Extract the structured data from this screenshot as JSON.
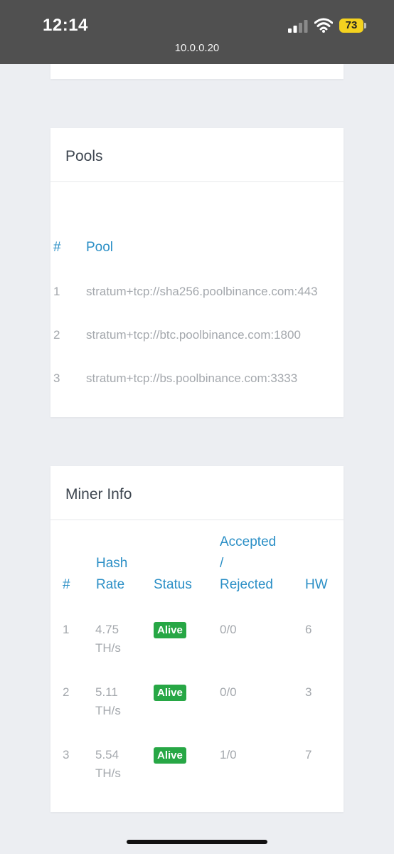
{
  "status_bar": {
    "time": "12:14",
    "url": "10.0.0.20",
    "battery": "73",
    "battery_color": "#f4d21f"
  },
  "pools": {
    "title": "Pools",
    "headers": {
      "index": "#",
      "pool": "Pool"
    },
    "rows": [
      {
        "index": "1",
        "url": "stratum+tcp://sha256.poolbinance.com:443"
      },
      {
        "index": "2",
        "url": "stratum+tcp://btc.poolbinance.com:1800"
      },
      {
        "index": "3",
        "url": "stratum+tcp://bs.poolbinance.com:3333"
      }
    ]
  },
  "miner_info": {
    "title": "Miner Info",
    "headers": {
      "index": "#",
      "hash_rate_1": "Hash",
      "hash_rate_2": "Rate",
      "status": "Status",
      "acc_1": "Accepted",
      "acc_2": "/",
      "acc_3": "Rejected",
      "hw": "HW"
    },
    "rows": [
      {
        "index": "1",
        "hash_value": "4.75",
        "hash_unit": "TH/s",
        "status": "Alive",
        "acc_rej": "0/0",
        "hw": "6"
      },
      {
        "index": "2",
        "hash_value": "5.11",
        "hash_unit": "TH/s",
        "status": "Alive",
        "acc_rej": "0/0",
        "hw": "3"
      },
      {
        "index": "3",
        "hash_value": "5.54",
        "hash_unit": "TH/s",
        "status": "Alive",
        "acc_rej": "1/0",
        "hw": "7"
      }
    ],
    "accent_color": "#2b8fc6",
    "status_color": "#27a745"
  }
}
